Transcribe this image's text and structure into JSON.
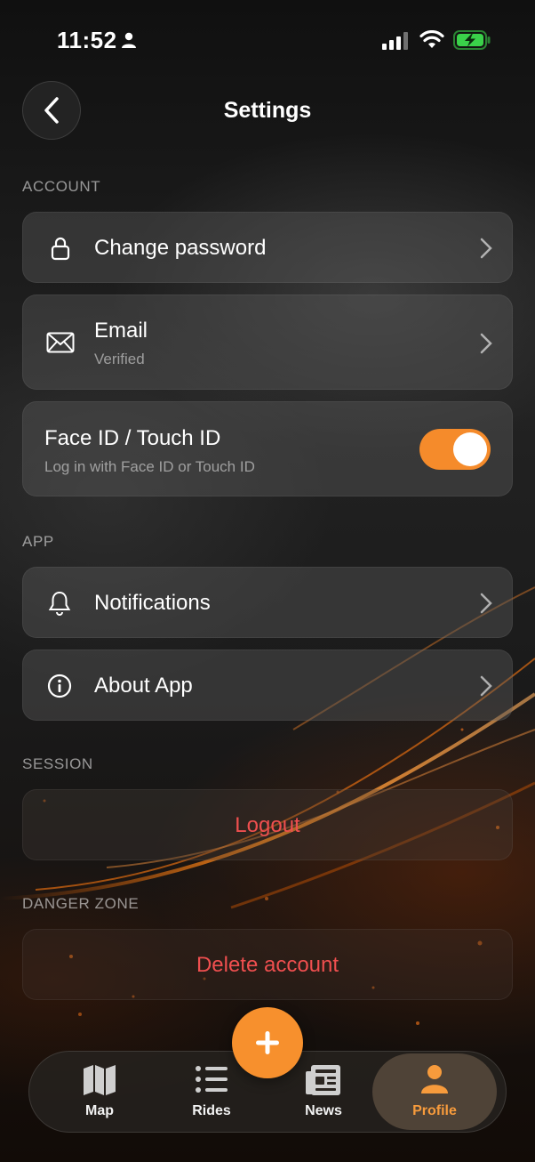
{
  "status_bar": {
    "time": "11:52"
  },
  "header": {
    "title": "Settings"
  },
  "sections": {
    "account": "ACCOUNT",
    "app": "APP",
    "session": "SESSION",
    "danger": "DANGER ZONE"
  },
  "rows": {
    "change_password": {
      "title": "Change password"
    },
    "email": {
      "title": "Email",
      "subtitle": "Verified"
    },
    "face_id": {
      "title": "Face ID / Touch ID",
      "subtitle": "Log in with Face ID or Touch ID",
      "enabled": true
    },
    "notifications": {
      "title": "Notifications"
    },
    "about": {
      "title": "About App"
    },
    "logout": {
      "title": "Logout"
    },
    "delete": {
      "title": "Delete account"
    }
  },
  "nav": {
    "items": [
      {
        "label": "Map",
        "icon": "map-icon"
      },
      {
        "label": "Rides",
        "icon": "list-icon"
      },
      {
        "label": "News",
        "icon": "newspaper-icon"
      },
      {
        "label": "Profile",
        "icon": "person-icon",
        "active": true
      }
    ]
  },
  "colors": {
    "accent": "#f7902d",
    "danger": "#ef4f4f",
    "battery": "#3ad14a"
  }
}
